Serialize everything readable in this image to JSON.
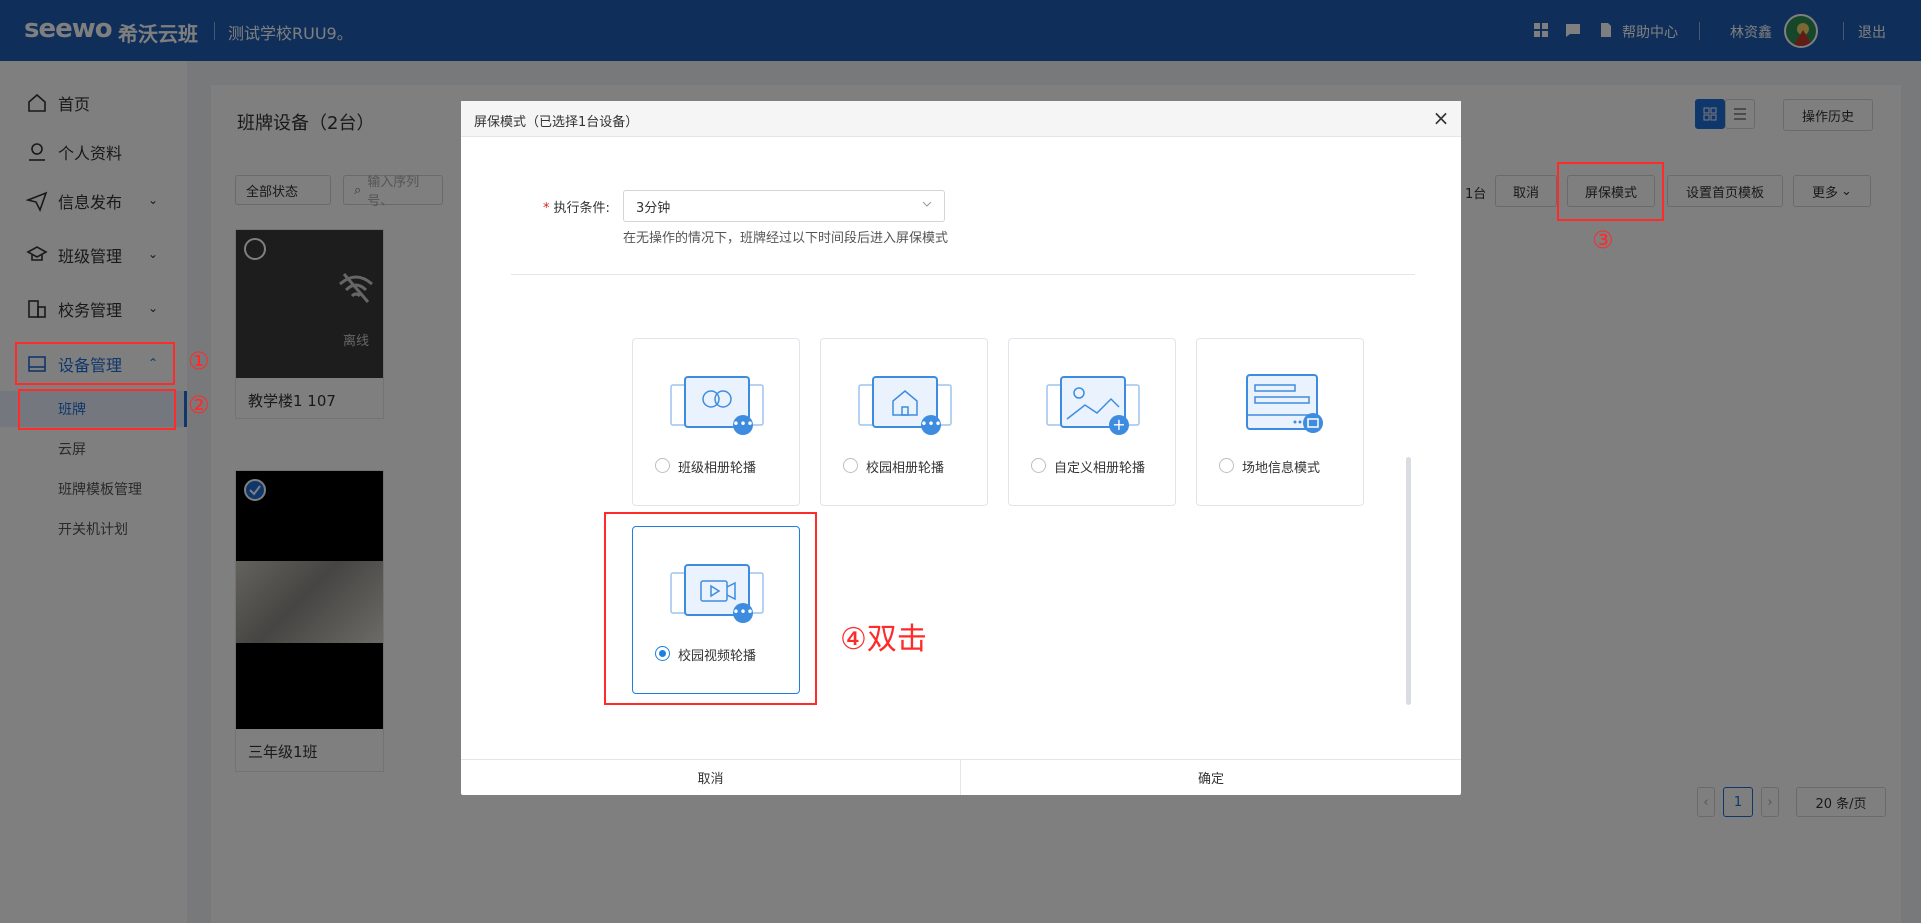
{
  "topbar": {
    "logo": "seewo",
    "brand": "希沃云班",
    "school": "测试学校RUU9。",
    "help": "帮助中心",
    "user": "林资鑫",
    "logout": "退出"
  },
  "sidebar": {
    "items": [
      {
        "label": "首页",
        "icon": "home-icon"
      },
      {
        "label": "个人资料",
        "icon": "user-icon"
      },
      {
        "label": "信息发布",
        "icon": "send-icon"
      },
      {
        "label": "班级管理",
        "icon": "class-icon"
      },
      {
        "label": "校务管理",
        "icon": "school-affairs-icon"
      },
      {
        "label": "设备管理",
        "icon": "device-icon"
      }
    ],
    "sub_items": [
      "班牌",
      "云屏",
      "班牌模板管理",
      "开关机计划"
    ]
  },
  "main": {
    "title": "班牌设备（2台）",
    "filter_status": "全部状态",
    "search_placeholder": "输入序列号、",
    "selected_count": "1台",
    "cancel": "取消",
    "screensaver": "屏保模式",
    "set_home_template": "设置首页模板",
    "more": "更多",
    "history": "操作历史",
    "devices": [
      {
        "name": "教学楼1 107",
        "status": "离线"
      },
      {
        "name": "三年级1班"
      }
    ],
    "pagination": {
      "page": "1",
      "page_size": "20 条/页"
    }
  },
  "modal": {
    "title": "屏保模式（已选择1台设备）",
    "condition_label": "执行条件:",
    "condition_value": "3分钟",
    "hint": "在无操作的情况下，班牌经过以下时间段后进入屏保模式",
    "modes": [
      {
        "label": "班级相册轮播",
        "icon": "class-album-icon",
        "selected": false
      },
      {
        "label": "校园相册轮播",
        "icon": "campus-album-icon",
        "selected": false
      },
      {
        "label": "自定义相册轮播",
        "icon": "custom-album-icon",
        "selected": false
      },
      {
        "label": "场地信息模式",
        "icon": "venue-info-icon",
        "selected": false
      },
      {
        "label": "校园视频轮播",
        "icon": "campus-video-icon",
        "selected": true
      }
    ],
    "cancel": "取消",
    "confirm": "确定"
  },
  "annotations": {
    "step1": "①",
    "step2": "②",
    "step3": "③",
    "step4": "④双击"
  },
  "colors": {
    "primary": "#1e5fb4",
    "accent": "#1e7fe0",
    "annotation": "#ff2a2a"
  }
}
